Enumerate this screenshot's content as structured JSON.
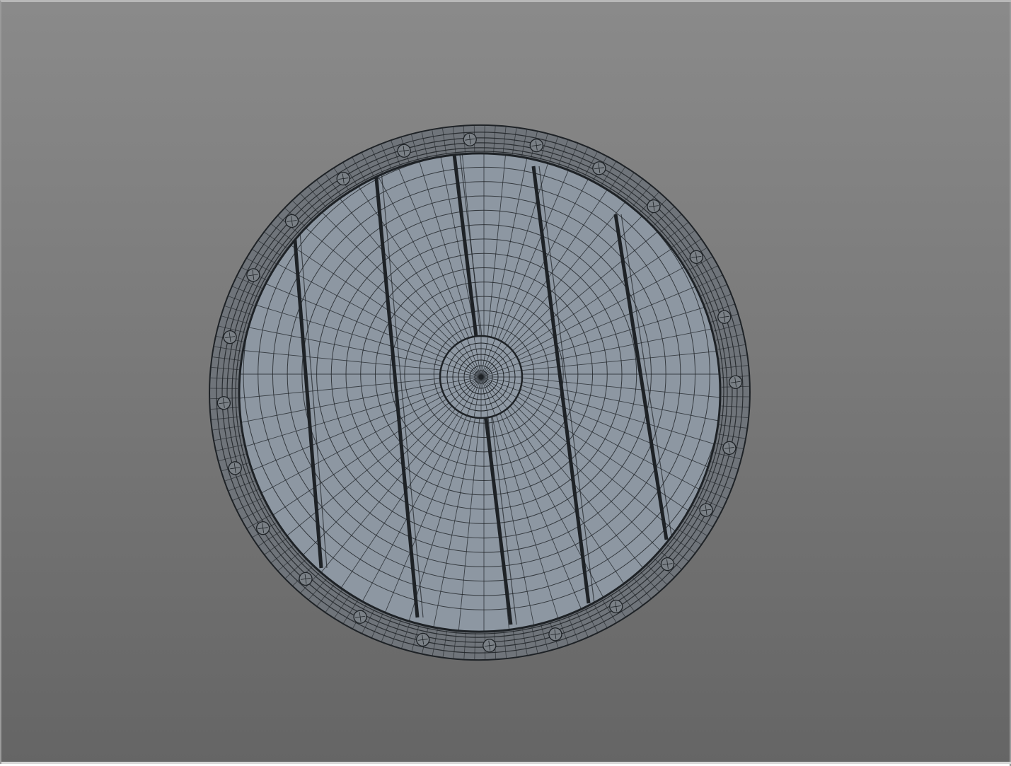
{
  "viewport": {
    "background_top": "#8a8a8a",
    "background_bottom": "#656565",
    "display_mode": "wireframe-on-shaded"
  },
  "model": {
    "object": "round-shield",
    "face_color": "#8d97a2",
    "rim_color": "#6f747a",
    "wire_color": "#1e2226",
    "rivet_count": 24,
    "plank_seams": 5,
    "radial_segments": 64,
    "rings": 14
  }
}
